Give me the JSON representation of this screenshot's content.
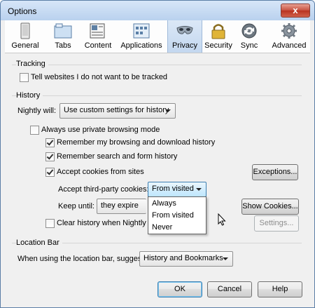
{
  "window": {
    "title": "Options",
    "close_label": "x"
  },
  "tabs": [
    {
      "label": "General",
      "icon": "general-icon"
    },
    {
      "label": "Tabs",
      "icon": "tabs-icon"
    },
    {
      "label": "Content",
      "icon": "content-icon"
    },
    {
      "label": "Applications",
      "icon": "applications-icon"
    },
    {
      "label": "Privacy",
      "icon": "privacy-mask-icon",
      "selected": true
    },
    {
      "label": "Security",
      "icon": "padlock-icon"
    },
    {
      "label": "Sync",
      "icon": "sync-icon"
    },
    {
      "label": "Advanced",
      "icon": "gear-icon"
    }
  ],
  "tracking": {
    "heading": "Tracking",
    "dnt_label": "Tell websites I do not want to be tracked",
    "dnt_checked": false
  },
  "history": {
    "heading": "History",
    "will_label": "Nightly will:",
    "will_value": "Use custom settings for history",
    "private_label": "Always use private browsing mode",
    "private_checked": false,
    "remember_browsing_label": "Remember my browsing and download history",
    "remember_browsing_checked": true,
    "remember_search_label": "Remember search and form history",
    "remember_search_checked": true,
    "accept_cookies_label": "Accept cookies from sites",
    "accept_cookies_checked": true,
    "exceptions_button": "Exceptions...",
    "third_party_label": "Accept third-party cookies:",
    "third_party_value": "From visited",
    "third_party_options": [
      "Always",
      "From visited",
      "Never"
    ],
    "keep_until_label": "Keep until:",
    "keep_until_value": "they expire",
    "show_cookies_button": "Show Cookies...",
    "clear_label": "Clear history when Nightly cl",
    "clear_checked": false,
    "settings_button": "Settings..."
  },
  "location_bar": {
    "heading": "Location Bar",
    "suggest_label": "When using the location bar, suggest:",
    "suggest_value": "History and Bookmarks"
  },
  "footer": {
    "ok_button": "OK",
    "cancel_button": "Cancel",
    "help_button": "Help"
  },
  "colors": {
    "title_bar": "#c3d9f2",
    "close_button": "#c7503e",
    "dialog_background": "#f0f0f0",
    "default_button_border": "#3c7fb1"
  }
}
